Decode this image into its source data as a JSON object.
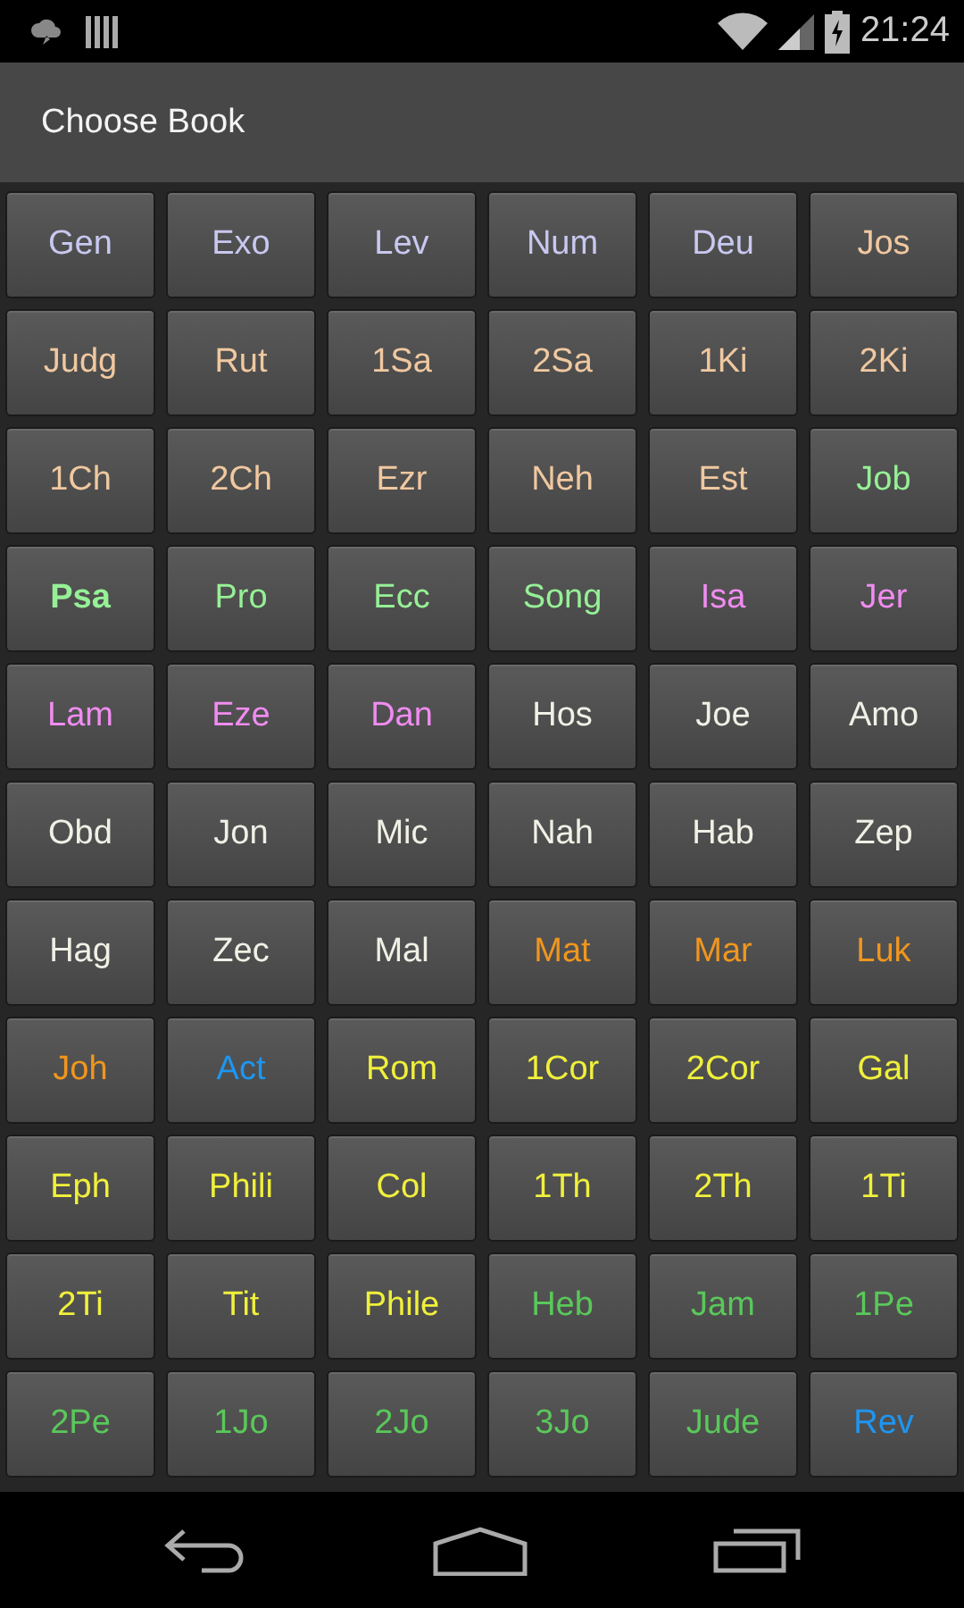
{
  "status_bar": {
    "time": "21:24"
  },
  "title": "Choose Book",
  "books": [
    {
      "label": "Gen",
      "color": "#c8c8f0",
      "selected": false
    },
    {
      "label": "Exo",
      "color": "#c8c8f0",
      "selected": false
    },
    {
      "label": "Lev",
      "color": "#c8c8f0",
      "selected": false
    },
    {
      "label": "Num",
      "color": "#c8c8f0",
      "selected": false
    },
    {
      "label": "Deu",
      "color": "#c8c8f0",
      "selected": false
    },
    {
      "label": "Jos",
      "color": "#f0c8a0",
      "selected": false
    },
    {
      "label": "Judg",
      "color": "#f0c8a0",
      "selected": false
    },
    {
      "label": "Rut",
      "color": "#f0c8a0",
      "selected": false
    },
    {
      "label": "1Sa",
      "color": "#f0c8a0",
      "selected": false
    },
    {
      "label": "2Sa",
      "color": "#f0c8a0",
      "selected": false
    },
    {
      "label": "1Ki",
      "color": "#f0c8a0",
      "selected": false
    },
    {
      "label": "2Ki",
      "color": "#f0c8a0",
      "selected": false
    },
    {
      "label": "1Ch",
      "color": "#f0c8a0",
      "selected": false
    },
    {
      "label": "2Ch",
      "color": "#f0c8a0",
      "selected": false
    },
    {
      "label": "Ezr",
      "color": "#f0c8a0",
      "selected": false
    },
    {
      "label": "Neh",
      "color": "#f0c8a0",
      "selected": false
    },
    {
      "label": "Est",
      "color": "#f0c8a0",
      "selected": false
    },
    {
      "label": "Job",
      "color": "#96f096",
      "selected": false
    },
    {
      "label": "Psa",
      "color": "#96f096",
      "selected": true
    },
    {
      "label": "Pro",
      "color": "#96f096",
      "selected": false
    },
    {
      "label": "Ecc",
      "color": "#96f096",
      "selected": false
    },
    {
      "label": "Song",
      "color": "#96f096",
      "selected": false
    },
    {
      "label": "Isa",
      "color": "#f08cf0",
      "selected": false
    },
    {
      "label": "Jer",
      "color": "#f08cf0",
      "selected": false
    },
    {
      "label": "Lam",
      "color": "#f08cf0",
      "selected": false
    },
    {
      "label": "Eze",
      "color": "#f08cf0",
      "selected": false
    },
    {
      "label": "Dan",
      "color": "#f08cf0",
      "selected": false
    },
    {
      "label": "Hos",
      "color": "#f0f0e6",
      "selected": false
    },
    {
      "label": "Joe",
      "color": "#f0f0e6",
      "selected": false
    },
    {
      "label": "Amo",
      "color": "#f0f0e6",
      "selected": false
    },
    {
      "label": "Obd",
      "color": "#f0f0e6",
      "selected": false
    },
    {
      "label": "Jon",
      "color": "#f0f0e6",
      "selected": false
    },
    {
      "label": "Mic",
      "color": "#f0f0e6",
      "selected": false
    },
    {
      "label": "Nah",
      "color": "#f0f0e6",
      "selected": false
    },
    {
      "label": "Hab",
      "color": "#f0f0e6",
      "selected": false
    },
    {
      "label": "Zep",
      "color": "#f0f0e6",
      "selected": false
    },
    {
      "label": "Hag",
      "color": "#f0f0e6",
      "selected": false
    },
    {
      "label": "Zec",
      "color": "#f0f0e6",
      "selected": false
    },
    {
      "label": "Mal",
      "color": "#f0f0e6",
      "selected": false
    },
    {
      "label": "Mat",
      "color": "#f0961e",
      "selected": false
    },
    {
      "label": "Mar",
      "color": "#f0961e",
      "selected": false
    },
    {
      "label": "Luk",
      "color": "#f0961e",
      "selected": false
    },
    {
      "label": "Joh",
      "color": "#f0961e",
      "selected": false
    },
    {
      "label": "Act",
      "color": "#1e96f0",
      "selected": false
    },
    {
      "label": "Rom",
      "color": "#f0f03c",
      "selected": false
    },
    {
      "label": "1Cor",
      "color": "#f0f03c",
      "selected": false
    },
    {
      "label": "2Cor",
      "color": "#f0f03c",
      "selected": false
    },
    {
      "label": "Gal",
      "color": "#f0f03c",
      "selected": false
    },
    {
      "label": "Eph",
      "color": "#f0f03c",
      "selected": false
    },
    {
      "label": "Phili",
      "color": "#f0f03c",
      "selected": false
    },
    {
      "label": "Col",
      "color": "#f0f03c",
      "selected": false
    },
    {
      "label": "1Th",
      "color": "#f0f03c",
      "selected": false
    },
    {
      "label": "2Th",
      "color": "#f0f03c",
      "selected": false
    },
    {
      "label": "1Ti",
      "color": "#f0f03c",
      "selected": false
    },
    {
      "label": "2Ti",
      "color": "#f0f03c",
      "selected": false
    },
    {
      "label": "Tit",
      "color": "#f0f03c",
      "selected": false
    },
    {
      "label": "Phile",
      "color": "#f0f03c",
      "selected": false
    },
    {
      "label": "Heb",
      "color": "#5ac85a",
      "selected": false
    },
    {
      "label": "Jam",
      "color": "#5ac85a",
      "selected": false
    },
    {
      "label": "1Pe",
      "color": "#5ac85a",
      "selected": false
    },
    {
      "label": "2Pe",
      "color": "#5ac85a",
      "selected": false
    },
    {
      "label": "1Jo",
      "color": "#5ac85a",
      "selected": false
    },
    {
      "label": "2Jo",
      "color": "#5ac85a",
      "selected": false
    },
    {
      "label": "3Jo",
      "color": "#5ac85a",
      "selected": false
    },
    {
      "label": "Jude",
      "color": "#5ac85a",
      "selected": false
    },
    {
      "label": "Rev",
      "color": "#1e96f0",
      "selected": false
    }
  ]
}
